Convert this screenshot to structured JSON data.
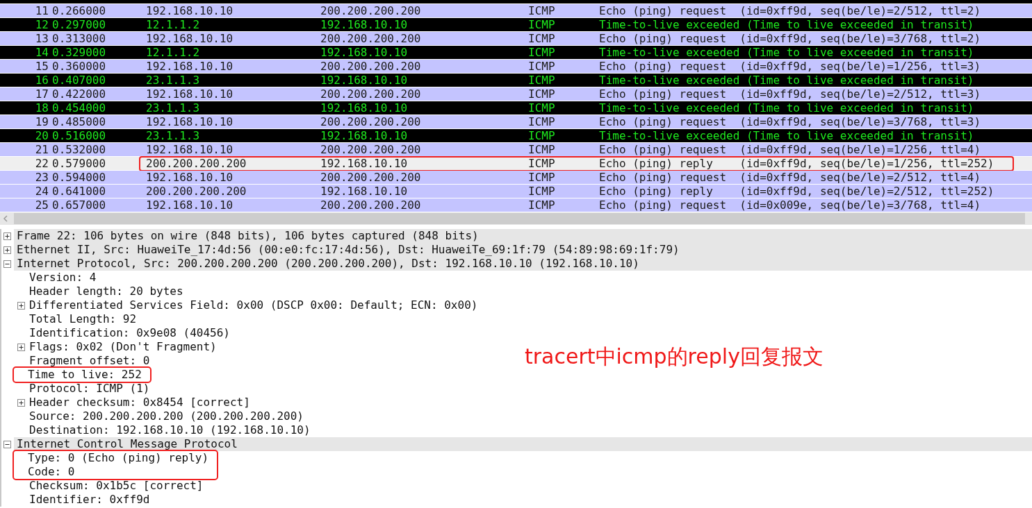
{
  "packets": [
    {
      "no": "11",
      "time": "0.266000",
      "source": "192.168.10.10",
      "destination": "200.200.200.200",
      "protocol": "ICMP",
      "info": "Echo (ping) request  (id=0xff9d, seq(be/le)=2/512, ttl=2)",
      "kind": "icmp",
      "selected": false,
      "annotated": false
    },
    {
      "no": "12",
      "time": "0.297000",
      "source": "12.1.1.2",
      "destination": "192.168.10.10",
      "protocol": "ICMP",
      "info": "Time-to-live exceeded (Time to live exceeded in transit)",
      "kind": "icmp-error",
      "selected": false,
      "annotated": false
    },
    {
      "no": "13",
      "time": "0.313000",
      "source": "192.168.10.10",
      "destination": "200.200.200.200",
      "protocol": "ICMP",
      "info": "Echo (ping) request  (id=0xff9d, seq(be/le)=3/768, ttl=2)",
      "kind": "icmp",
      "selected": false,
      "annotated": false
    },
    {
      "no": "14",
      "time": "0.329000",
      "source": "12.1.1.2",
      "destination": "192.168.10.10",
      "protocol": "ICMP",
      "info": "Time-to-live exceeded (Time to live exceeded in transit)",
      "kind": "icmp-error",
      "selected": false,
      "annotated": false
    },
    {
      "no": "15",
      "time": "0.360000",
      "source": "192.168.10.10",
      "destination": "200.200.200.200",
      "protocol": "ICMP",
      "info": "Echo (ping) request  (id=0xff9d, seq(be/le)=1/256, ttl=3)",
      "kind": "icmp",
      "selected": false,
      "annotated": false
    },
    {
      "no": "16",
      "time": "0.407000",
      "source": "23.1.1.3",
      "destination": "192.168.10.10",
      "protocol": "ICMP",
      "info": "Time-to-live exceeded (Time to live exceeded in transit)",
      "kind": "icmp-error",
      "selected": false,
      "annotated": false
    },
    {
      "no": "17",
      "time": "0.422000",
      "source": "192.168.10.10",
      "destination": "200.200.200.200",
      "protocol": "ICMP",
      "info": "Echo (ping) request  (id=0xff9d, seq(be/le)=2/512, ttl=3)",
      "kind": "icmp",
      "selected": false,
      "annotated": false
    },
    {
      "no": "18",
      "time": "0.454000",
      "source": "23.1.1.3",
      "destination": "192.168.10.10",
      "protocol": "ICMP",
      "info": "Time-to-live exceeded (Time to live exceeded in transit)",
      "kind": "icmp-error",
      "selected": false,
      "annotated": false
    },
    {
      "no": "19",
      "time": "0.485000",
      "source": "192.168.10.10",
      "destination": "200.200.200.200",
      "protocol": "ICMP",
      "info": "Echo (ping) request  (id=0xff9d, seq(be/le)=3/768, ttl=3)",
      "kind": "icmp",
      "selected": false,
      "annotated": false
    },
    {
      "no": "20",
      "time": "0.516000",
      "source": "23.1.1.3",
      "destination": "192.168.10.10",
      "protocol": "ICMP",
      "info": "Time-to-live exceeded (Time to live exceeded in transit)",
      "kind": "icmp-error",
      "selected": false,
      "annotated": false
    },
    {
      "no": "21",
      "time": "0.532000",
      "source": "192.168.10.10",
      "destination": "200.200.200.200",
      "protocol": "ICMP",
      "info": "Echo (ping) request  (id=0xff9d, seq(be/le)=1/256, ttl=4)",
      "kind": "icmp",
      "selected": false,
      "annotated": false
    },
    {
      "no": "22",
      "time": "0.579000",
      "source": "200.200.200.200",
      "destination": "192.168.10.10",
      "protocol": "ICMP",
      "info": "Echo (ping) reply    (id=0xff9d, seq(be/le)=1/256, ttl=252)",
      "kind": "icmp",
      "selected": true,
      "annotated": true
    },
    {
      "no": "23",
      "time": "0.594000",
      "source": "192.168.10.10",
      "destination": "200.200.200.200",
      "protocol": "ICMP",
      "info": "Echo (ping) request  (id=0xff9d, seq(be/le)=2/512, ttl=4)",
      "kind": "icmp",
      "selected": false,
      "annotated": false
    },
    {
      "no": "24",
      "time": "0.641000",
      "source": "200.200.200.200",
      "destination": "192.168.10.10",
      "protocol": "ICMP",
      "info": "Echo (ping) reply    (id=0xff9d, seq(be/le)=2/512, ttl=252)",
      "kind": "icmp",
      "selected": false,
      "annotated": false
    },
    {
      "no": "25",
      "time": "0.657000",
      "source": "192.168.10.10",
      "destination": "200.200.200.200",
      "protocol": "ICMP",
      "info": "Echo (ping) request  (id=0x009e, seq(be/le)=3/768, ttl=4)",
      "kind": "icmp",
      "selected": false,
      "annotated": false
    }
  ],
  "details": [
    {
      "text": "Frame 22: 106 bytes on wire (848 bits), 106 bytes captured (848 bits)",
      "expanded": false,
      "annotated": false
    },
    {
      "text": "Ethernet II, Src: HuaweiTe_17:4d:56 (00:e0:fc:17:4d:56), Dst: HuaweiTe_69:1f:79 (54:89:98:69:1f:79)",
      "expanded": false,
      "annotated": false
    },
    {
      "text": "Internet Protocol, Src: 200.200.200.200 (200.200.200.200), Dst: 192.168.10.10 (192.168.10.10)",
      "expanded": true,
      "annotated": false,
      "children": [
        {
          "text": "Version: 4",
          "annotated": false
        },
        {
          "text": "Header length: 20 bytes",
          "annotated": false
        },
        {
          "text": "Differentiated Services Field: 0x00 (DSCP 0x00: Default; ECN: 0x00)",
          "expanded": false,
          "annotated": false
        },
        {
          "text": "Total Length: 92",
          "annotated": false
        },
        {
          "text": "Identification: 0x9e08 (40456)",
          "annotated": false
        },
        {
          "text": "Flags: 0x02 (Don't Fragment)",
          "expanded": false,
          "annotated": false
        },
        {
          "text": "Fragment offset: 0",
          "annotated": false
        },
        {
          "text": "Time to live: 252",
          "annotated": true
        },
        {
          "text": "Protocol: ICMP (1)",
          "annotated": false
        },
        {
          "text": "Header checksum: 0x8454 [correct]",
          "expanded": false,
          "annotated": false
        },
        {
          "text": "Source: 200.200.200.200 (200.200.200.200)",
          "annotated": false
        },
        {
          "text": "Destination: 192.168.10.10 (192.168.10.10)",
          "annotated": false
        }
      ]
    },
    {
      "text": "Internet Control Message Protocol",
      "expanded": true,
      "annotated": false,
      "children": [
        {
          "text": "Type: 0 (Echo (ping) reply)",
          "annotated": true
        },
        {
          "text": "Code: 0",
          "annotated": true
        },
        {
          "text": "Checksum: 0x1b5c [correct]",
          "annotated": false
        },
        {
          "text": "Identifier: 0xff9d",
          "annotated": false
        }
      ]
    }
  ],
  "annotation": "tracert中icmp的reply回复报文"
}
